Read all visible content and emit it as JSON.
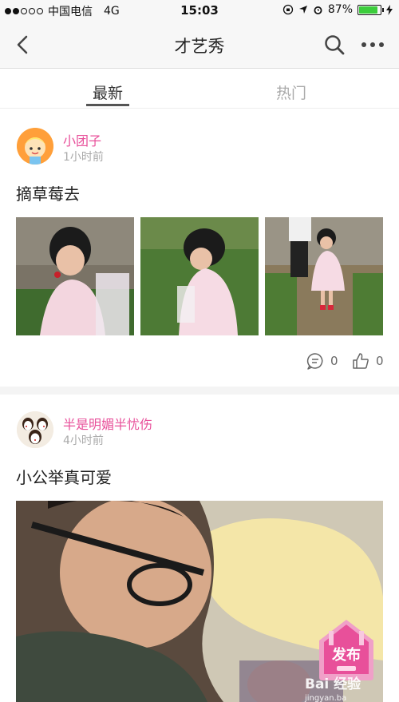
{
  "status_bar": {
    "carrier": "中国电信",
    "network": "4G",
    "time": "15:03",
    "battery_percent": "87%",
    "battery_level": 0.87,
    "signal_bars_filled": 2,
    "signal_bars_total": 5,
    "battery_color": "#3ccd3c"
  },
  "nav": {
    "title": "才艺秀",
    "back_icon": "chevron-left-icon",
    "search_icon": "search-icon",
    "more_icon": "more-horizontal-icon"
  },
  "tabs": [
    {
      "label": "最新",
      "active": true
    },
    {
      "label": "热门",
      "active": false
    }
  ],
  "accent_color": "#e8509a",
  "posts": [
    {
      "username": "小团子",
      "time": "1小时前",
      "text": "摘草莓去",
      "comment_count": "0",
      "like_count": "0"
    },
    {
      "username": "半是明媚半忧伤",
      "time": "4小时前",
      "text": "小公举真可爱"
    }
  ],
  "fab": {
    "label": "发布",
    "icon": "house-badge-icon"
  },
  "watermark": {
    "brand": "Bai 经验",
    "url": "jingyan.ba"
  }
}
